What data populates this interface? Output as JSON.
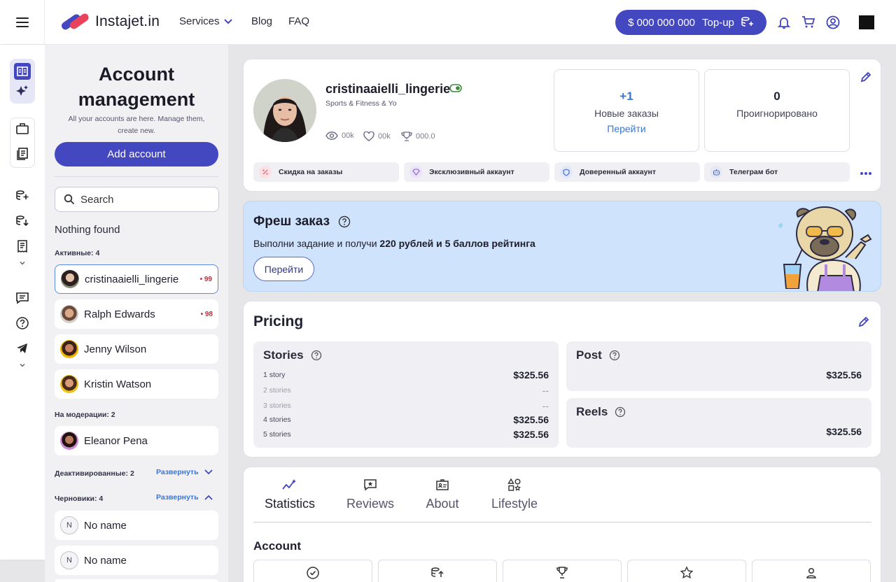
{
  "header": {
    "logo_text": "Instajet.in",
    "nav": [
      {
        "label": "Services",
        "has_dropdown": true
      },
      {
        "label": "Blog"
      },
      {
        "label": "FAQ"
      }
    ],
    "balance": "$ 000 000 000",
    "topup_label": "Top-up"
  },
  "sidebar": {
    "title": "Account management",
    "subtitle": "All your accounts are here. Manage them, create new.",
    "add_account_label": "Add account",
    "search_placeholder": "Search",
    "nothing_found": "Nothing found",
    "sections": {
      "active": {
        "label": "Активные: 4",
        "accounts": [
          {
            "name": "cristinaaielli_lingerie",
            "badge": "• 99"
          },
          {
            "name": "Ralph Edwards",
            "badge": "• 98"
          },
          {
            "name": "Jenny Wilson",
            "badge": ""
          },
          {
            "name": "Kristin Watson",
            "badge": ""
          }
        ]
      },
      "moderation": {
        "label": "На модерации: 2",
        "accounts": [
          {
            "name": "Eleanor Pena"
          }
        ]
      },
      "deactivated": {
        "label": "Деактивированные: 2",
        "expand": "Развернуть"
      },
      "drafts": {
        "label": "Черновики: 4",
        "expand": "Развернуть",
        "accounts": [
          {
            "initial": "N",
            "name": "No name"
          },
          {
            "initial": "N",
            "name": "No name"
          }
        ]
      }
    }
  },
  "profile": {
    "username": "cristinaaielli_lingerie",
    "category": "Sports & Fitness & Yo",
    "views": "00k",
    "likes": "00k",
    "rating": "000.0",
    "new_orders": {
      "value": "+1",
      "label": "Новые заказы",
      "link": "Перейти"
    },
    "ignored": {
      "value": "0",
      "label": "Проигнорировано"
    },
    "chips": [
      {
        "label": "Скидка на заказы",
        "icon": "percent-icon"
      },
      {
        "label": "Эксклюзивный аккаунт",
        "icon": "diamond-icon"
      },
      {
        "label": "Доверенный аккаунт",
        "icon": "shield-icon"
      },
      {
        "label": "Телеграм бот",
        "icon": "bot-icon"
      }
    ]
  },
  "promo": {
    "title": "Фреш заказ",
    "text_prefix": "Выполни задание и получи ",
    "text_bold": "220 рублей и 5 баллов рейтинга",
    "button": "Перейти"
  },
  "pricing": {
    "title": "Pricing",
    "stories": {
      "title": "Stories",
      "rows": [
        {
          "label": "1 story",
          "value": "$325.56"
        },
        {
          "label": "2 stories",
          "value": "--"
        },
        {
          "label": "3 stories",
          "value": "--"
        },
        {
          "label": "4 stories",
          "value": "$325.56"
        },
        {
          "label": "5 stories",
          "value": "$325.56"
        }
      ]
    },
    "post": {
      "title": "Post",
      "value": "$325.56"
    },
    "reels": {
      "title": "Reels",
      "value": "$325.56"
    }
  },
  "tabs": [
    {
      "label": "Statistics",
      "icon": "chart-sparkle-icon",
      "active": true
    },
    {
      "label": "Reviews",
      "icon": "review-icon"
    },
    {
      "label": "About",
      "icon": "id-card-icon"
    },
    {
      "label": "Lifestyle",
      "icon": "shapes-icon"
    }
  ],
  "account_section": {
    "title": "Account"
  },
  "colors": {
    "primary": "#4347c0",
    "link": "#3a76d2",
    "promo_bg": "#cfe4fc",
    "badge_red": "#b73040"
  }
}
